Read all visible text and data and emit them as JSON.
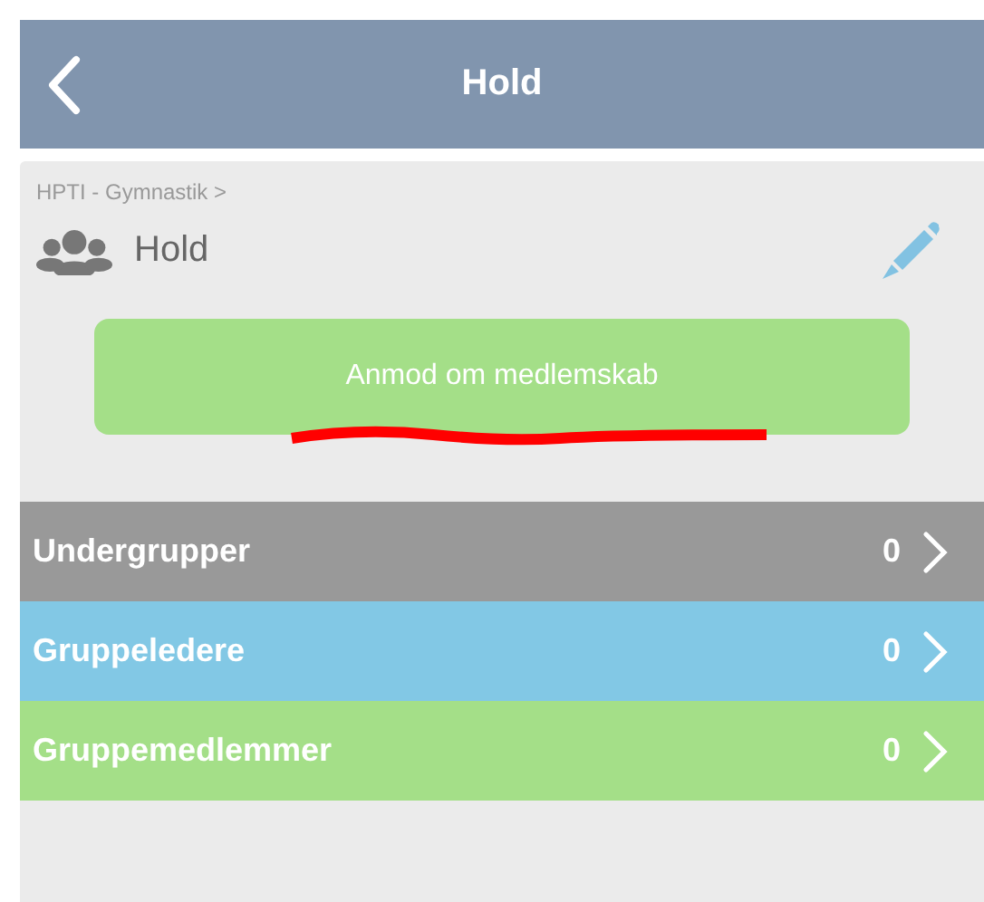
{
  "header": {
    "title": "Hold"
  },
  "group": {
    "breadcrumb": "HPTI - Gymnastik >",
    "name": "Hold"
  },
  "request_button": {
    "label": "Anmod om medlemskab"
  },
  "sections": [
    {
      "label": "Undergrupper",
      "count": "0",
      "color": "#999999"
    },
    {
      "label": "Gruppeledere",
      "count": "0",
      "color": "#82c8e5"
    },
    {
      "label": "Gruppemedlemmer",
      "count": "0",
      "color": "#a4df88"
    }
  ]
}
